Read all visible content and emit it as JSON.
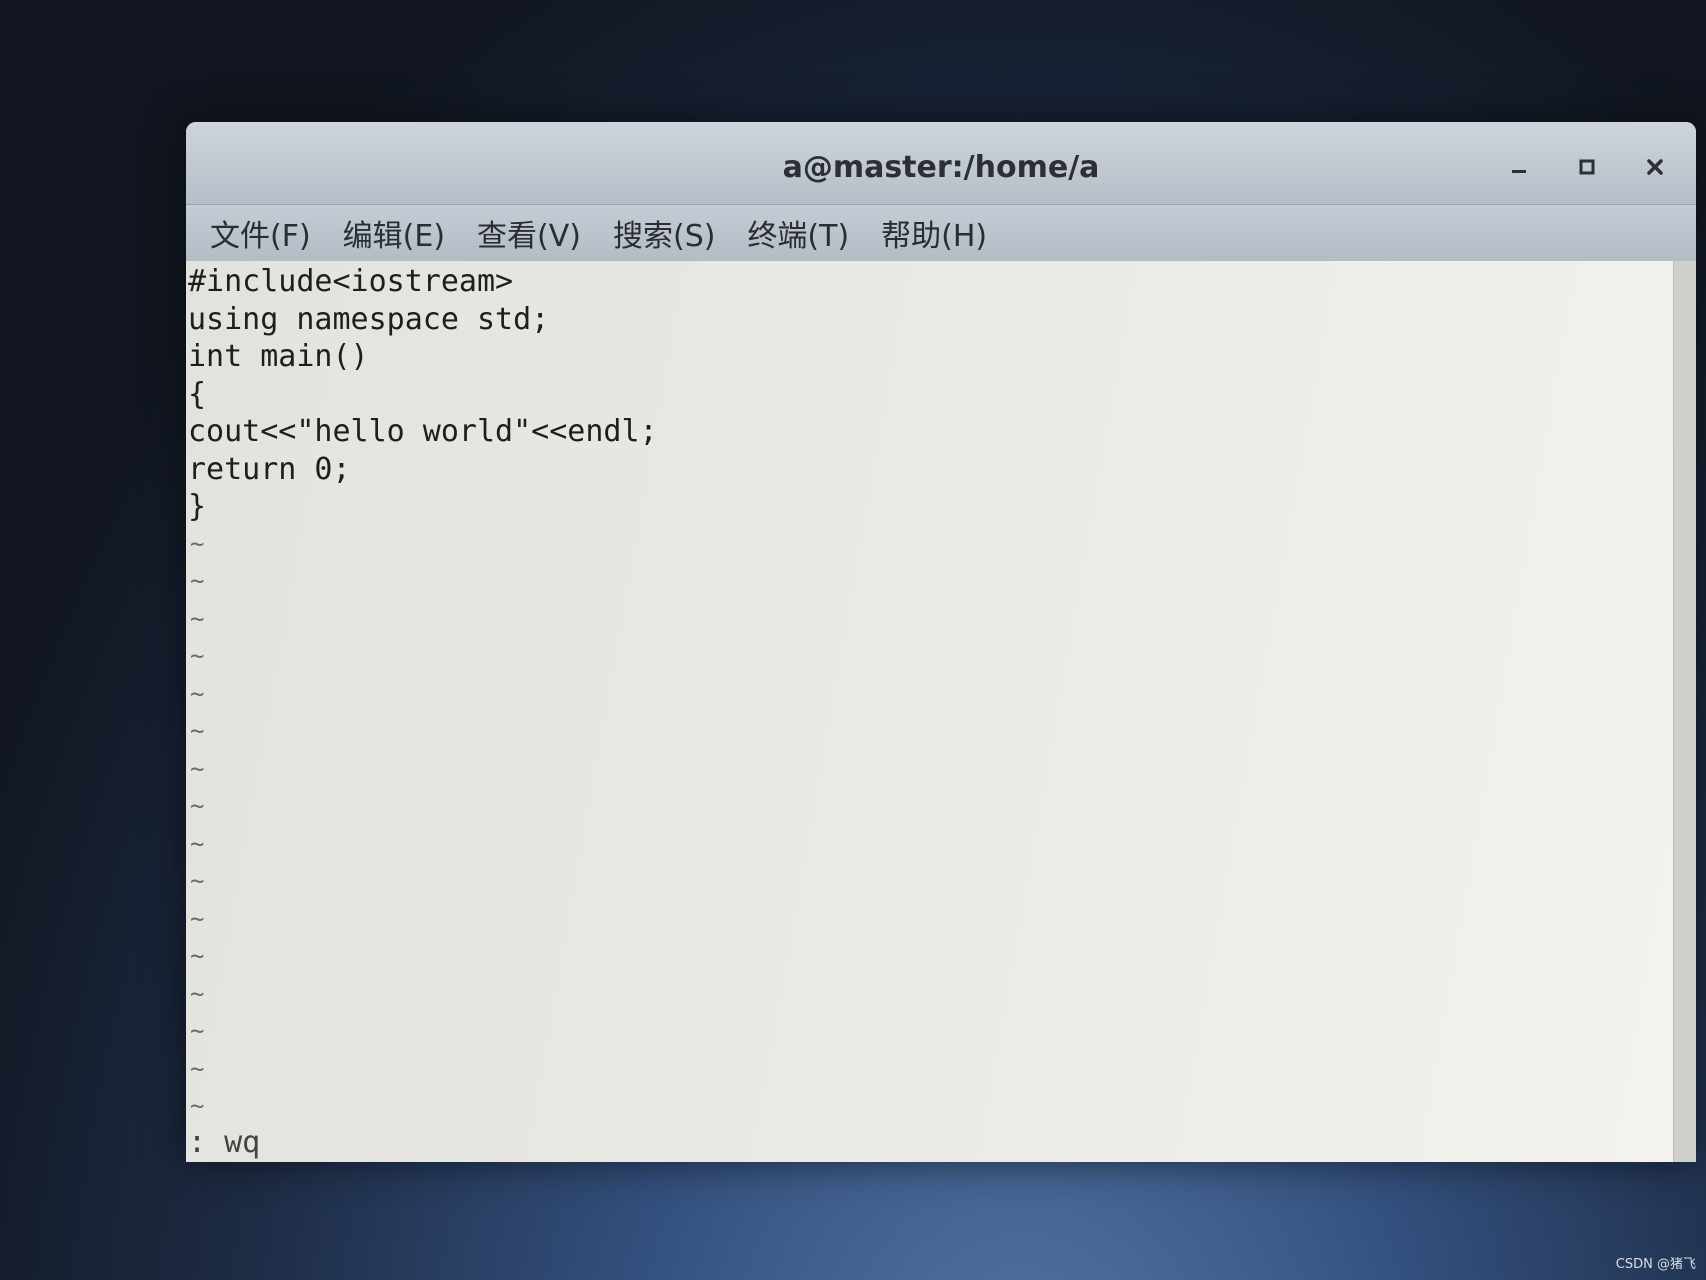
{
  "window": {
    "title": "a@master:/home/a"
  },
  "menu": [
    {
      "label": "文件(F)"
    },
    {
      "label": "编辑(E)"
    },
    {
      "label": "查看(V)"
    },
    {
      "label": "搜索(S)"
    },
    {
      "label": "终端(T)"
    },
    {
      "label": "帮助(H)"
    }
  ],
  "editor": {
    "lines": [
      "#include<iostream>",
      "using namespace std;",
      "int main()",
      "{",
      "cout<<\"hello world\"<<endl;",
      "return 0;",
      "}"
    ],
    "tilde": "~",
    "command": ": wq"
  },
  "watermark": "CSDN @猪飞"
}
